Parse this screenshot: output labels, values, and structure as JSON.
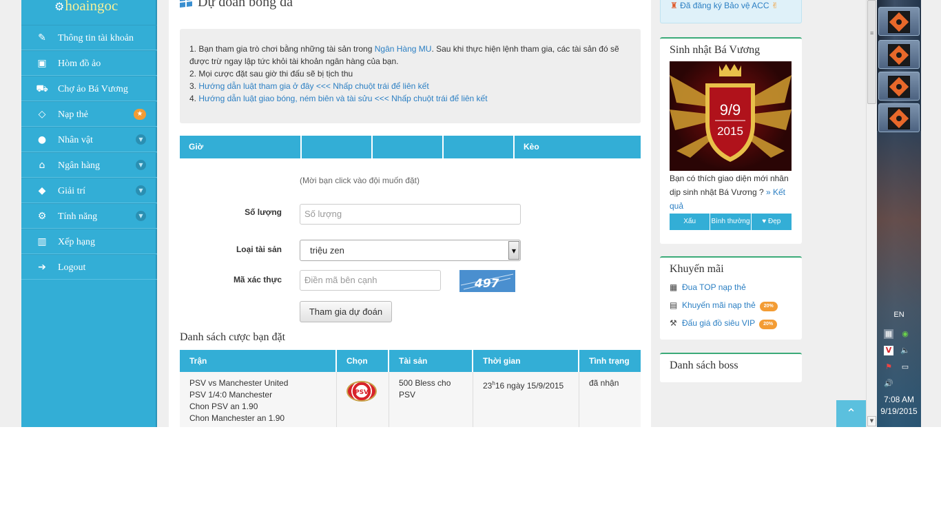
{
  "sidebar": {
    "logo": "hoaingoc",
    "items": [
      {
        "label": "Thông tin tài khoản",
        "icon": "edit-icon",
        "glyph": "✎",
        "badge": ""
      },
      {
        "label": "Hòm đồ ảo",
        "icon": "briefcase-icon",
        "glyph": "▣",
        "badge": ""
      },
      {
        "label": "Chợ ảo Bá Vương",
        "icon": "cart-icon",
        "glyph": "⛟",
        "badge": ""
      },
      {
        "label": "Nạp thẻ",
        "icon": "diamond-icon",
        "glyph": "◇",
        "badge": "star"
      },
      {
        "label": "Nhân vật",
        "icon": "user-icon",
        "glyph": "●",
        "badge": "chevron"
      },
      {
        "label": "Ngân hàng",
        "icon": "bank-icon",
        "glyph": "⌂",
        "badge": "chevron"
      },
      {
        "label": "Giải trí",
        "icon": "android-icon",
        "glyph": "◆",
        "badge": "chevron"
      },
      {
        "label": "Tính năng",
        "icon": "cogs-icon",
        "glyph": "⚙",
        "badge": "chevron"
      },
      {
        "label": "Xếp hạng",
        "icon": "bar-chart-icon",
        "glyph": "▥",
        "badge": ""
      },
      {
        "label": "Logout",
        "icon": "sign-out-icon",
        "glyph": "➔",
        "badge": ""
      }
    ]
  },
  "main": {
    "title": "Dự đoán bóng đá",
    "notice": {
      "line1_pre": "1. Bạn tham gia trò chơi bằng những tài sản trong ",
      "line1_link": "Ngân Hàng MU",
      "line1_post": ". Sau khi thực hiện lệnh tham gia, các tài sản đó sẽ được trừ ngay lập tức khỏi tài khoản ngân hàng của bạn.",
      "line2": "2. Mọi cược đặt sau giờ thi đấu sẽ bị tịch thu",
      "line3_pre": "3. ",
      "line3_link": "Hướng dẫn luật tham gia ở đây <<< Nhấp chuột trái để liên kết",
      "line4_pre": "4. ",
      "line4_link": "Hướng dẫn luật giao bóng, ném biên và tài sửu <<< Nhấp chuột trái để liên kết"
    },
    "match_table": {
      "headers": [
        "Giờ",
        "",
        "",
        "",
        "Kèo"
      ]
    },
    "form": {
      "hint": "(Mời bạn click vào đội muốn đặt)",
      "quantity_label": "Số lượng",
      "quantity_placeholder": "Số lượng",
      "asset_label": "Loại tài sản",
      "asset_value": "triệu zen",
      "captcha_label": "Mã xác thực",
      "captcha_placeholder": "Điền mã bên cạnh",
      "captcha_code": "497",
      "submit": "Tham gia dự đoán"
    },
    "bets": {
      "title": "Danh sách cược bạn đặt",
      "headers": [
        "Trận",
        "Chọn",
        "Tài sản",
        "Thời gian",
        "Tình trạng"
      ],
      "rows": [
        {
          "match": [
            "PSV vs Manchester United",
            "PSV 1/4:0 Manchester",
            "Chon PSV an 1.90",
            "Chon Manchester an 1.90"
          ],
          "choice_logo": "PSV",
          "asset": "500 Bless cho PSV",
          "time_hour": "23",
          "time_sup": "h",
          "time_rest": "16 ngày 15/9/2015",
          "status": "đã nhận"
        }
      ]
    }
  },
  "right": {
    "acc_notice": "Đã đăng ký Bảo vệ ACC",
    "birthday": {
      "title": "Sinh nhật Bá Vương",
      "img_date": "9/9",
      "img_year": "2015",
      "question": "Bạn có thích giao diện mới nhân dịp sinh nhật Bá Vương ? ",
      "result_link": "» Kết quả",
      "votes": [
        "Xấu",
        "Bình thường",
        "♥ Đẹp"
      ]
    },
    "promo": {
      "title": "Khuyến mãi",
      "items": [
        {
          "label": "Đua TOP nạp thẻ",
          "icon": "gift-icon",
          "glyph": "🎁",
          "badge": ""
        },
        {
          "label": "Khuyến mãi nạp thẻ",
          "icon": "money-icon",
          "glyph": "▤",
          "badge": "20%"
        },
        {
          "label": "Đấu giá đồ siêu VIP",
          "icon": "gavel-icon",
          "glyph": "⚒",
          "badge": "20%"
        }
      ]
    },
    "boss": {
      "title": "Danh sách boss"
    }
  },
  "taskbar": {
    "lang": "EN",
    "time": "7:08 AM",
    "date": "9/19/2015"
  },
  "colors": {
    "accent": "#33aed6",
    "link": "#2b7fc3",
    "badge": "#f39c34",
    "box_border": "#3aaa78"
  }
}
